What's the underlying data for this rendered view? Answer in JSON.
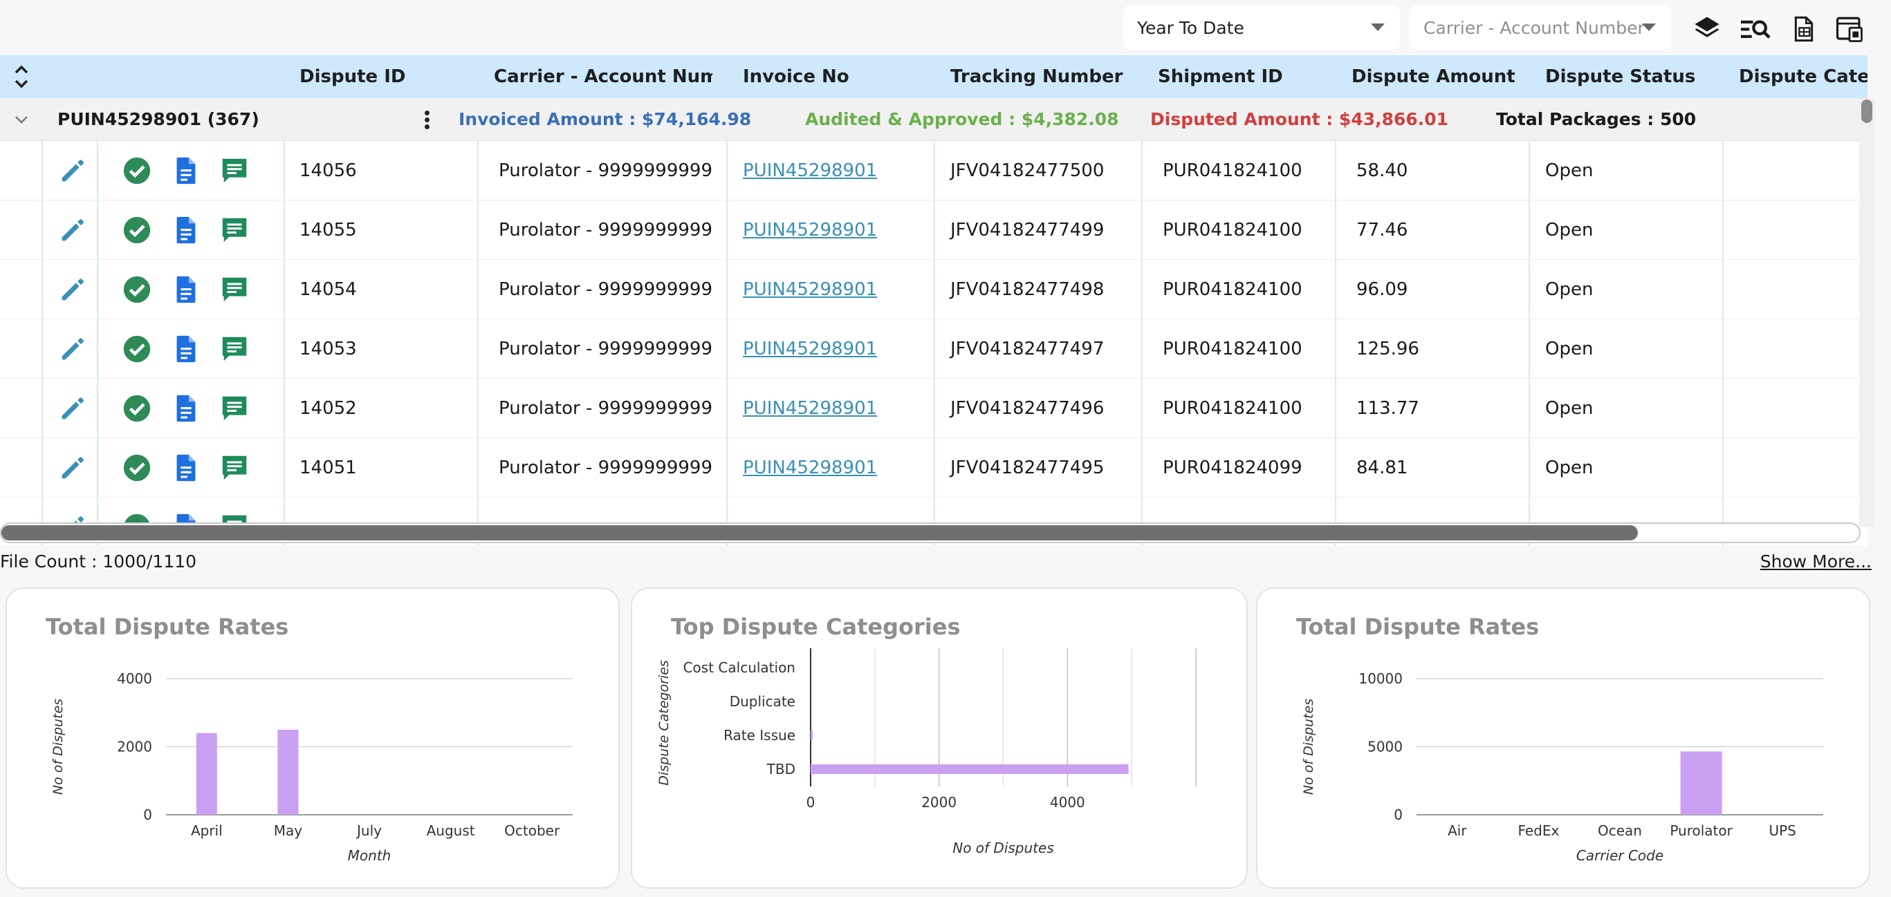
{
  "filters": {
    "period": "Year To Date",
    "carrier_placeholder": "Carrier - Account Number"
  },
  "toolbar_icons": [
    "layers-icon",
    "search-list-icon",
    "excel-export-icon",
    "column-settings-icon"
  ],
  "grid": {
    "columns": [
      "Dispute ID",
      "Carrier - Account Number",
      "Invoice No",
      "Tracking Number",
      "Shipment ID",
      "Dispute Amount",
      "Dispute Status",
      "Dispute Categ"
    ],
    "group": {
      "label": "PUIN45298901 (367)",
      "invoiced": "Invoiced Amount : $74,164.98",
      "audited": "Audited & Approved : $4,382.08",
      "disputed": "Disputed Amount : $43,866.01",
      "packages": "Total Packages : 500"
    },
    "rows": [
      {
        "id": "14056",
        "carrier": "Purolator - 9999999999",
        "invoice": "PUIN45298901",
        "tracking": "JFV04182477500",
        "shipment": "PUR041824100",
        "amount": "58.40",
        "status": "Open"
      },
      {
        "id": "14055",
        "carrier": "Purolator - 9999999999",
        "invoice": "PUIN45298901",
        "tracking": "JFV04182477499",
        "shipment": "PUR041824100",
        "amount": "77.46",
        "status": "Open"
      },
      {
        "id": "14054",
        "carrier": "Purolator - 9999999999",
        "invoice": "PUIN45298901",
        "tracking": "JFV04182477498",
        "shipment": "PUR041824100",
        "amount": "96.09",
        "status": "Open"
      },
      {
        "id": "14053",
        "carrier": "Purolator - 9999999999",
        "invoice": "PUIN45298901",
        "tracking": "JFV04182477497",
        "shipment": "PUR041824100",
        "amount": "125.96",
        "status": "Open"
      },
      {
        "id": "14052",
        "carrier": "Purolator - 9999999999",
        "invoice": "PUIN45298901",
        "tracking": "JFV04182477496",
        "shipment": "PUR041824100",
        "amount": "113.77",
        "status": "Open"
      },
      {
        "id": "14051",
        "carrier": "Purolator - 9999999999",
        "invoice": "PUIN45298901",
        "tracking": "JFV04182477495",
        "shipment": "PUR041824099",
        "amount": "84.81",
        "status": "Open"
      }
    ]
  },
  "footer": {
    "file_count": "File Count : 1000/1110",
    "show_more": "Show More..."
  },
  "colors": {
    "header_bg": "#cde9fb",
    "invoiced": "#3b6fb6",
    "audited": "#6ab04c",
    "disputed": "#d23f3f",
    "edit_icon": "#3a8fb7",
    "approve_icon": "#2e8b57",
    "doc_icon": "#1f6fe0",
    "comment_icon": "#1f8a5a",
    "bar": "#c9a0f2"
  },
  "chart_data": [
    {
      "type": "bar",
      "title": "Total Dispute Rates",
      "categories": [
        "April",
        "May",
        "July",
        "August",
        "October"
      ],
      "values": [
        2400,
        2500,
        0,
        0,
        0
      ],
      "xlabel": "Month",
      "ylabel": "No of Disputes",
      "ylim": [
        0,
        4000
      ],
      "yticks": [
        0,
        2000,
        4000
      ],
      "grid": true
    },
    {
      "type": "bar",
      "orientation": "horizontal",
      "title": "Top Dispute Categories",
      "categories": [
        "Cost Calculation",
        "Duplicate",
        "Rate Issue",
        "TBD"
      ],
      "values": [
        0,
        0,
        20,
        4950
      ],
      "xlabel": "No of Disputes",
      "ylabel": "Dispute Categories",
      "xlim": [
        0,
        6000
      ],
      "xticks": [
        0,
        2000,
        4000
      ],
      "grid": true
    },
    {
      "type": "bar",
      "title": "Total Dispute Rates",
      "categories": [
        "Air",
        "FedEx",
        "Ocean",
        "Purolator",
        "UPS"
      ],
      "values": [
        0,
        0,
        0,
        4650,
        0
      ],
      "xlabel": "Carrier Code",
      "ylabel": "No of Disputes",
      "ylim": [
        0,
        10000
      ],
      "yticks": [
        0,
        5000,
        10000
      ],
      "grid": true
    }
  ]
}
